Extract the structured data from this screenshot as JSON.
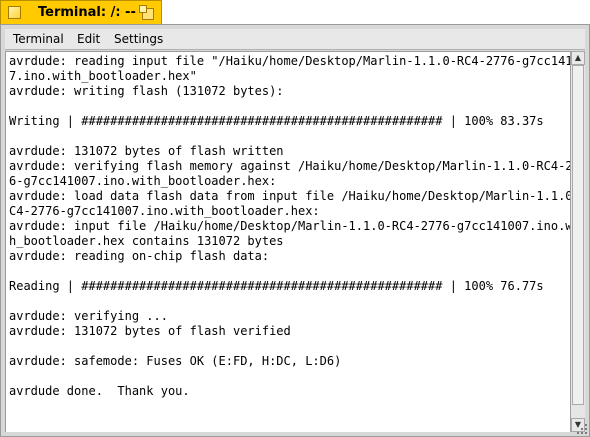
{
  "window": {
    "title": "Terminal: /: --"
  },
  "menu": {
    "items": [
      "Terminal",
      "Edit",
      "Settings"
    ]
  },
  "terminal": {
    "lines": [
      "avrdude: reading input file \"/Haiku/home/Desktop/Marlin-1.1.0-RC4-2776-g7cc14100",
      "7.ino.with_bootloader.hex\"",
      "avrdude: writing flash (131072 bytes):",
      "",
      "Writing | ################################################## | 100% 83.37s",
      "",
      "avrdude: 131072 bytes of flash written",
      "avrdude: verifying flash memory against /Haiku/home/Desktop/Marlin-1.1.0-RC4-277",
      "6-g7cc141007.ino.with_bootloader.hex:",
      "avrdude: load data flash data from input file /Haiku/home/Desktop/Marlin-1.1.0-R",
      "C4-2776-g7cc141007.ino.with_bootloader.hex:",
      "avrdude: input file /Haiku/home/Desktop/Marlin-1.1.0-RC4-2776-g7cc141007.ino.wit",
      "h_bootloader.hex contains 131072 bytes",
      "avrdude: reading on-chip flash data:",
      "",
      "Reading | ################################################## | 100% 76.77s",
      "",
      "avrdude: verifying ...",
      "avrdude: 131072 bytes of flash verified",
      "",
      "avrdude: safemode: Fuses OK (E:FD, H:DC, L:D6)",
      "",
      "avrdude done.  Thank you.",
      ""
    ],
    "prompt": "/> "
  },
  "colors": {
    "tab": "#ffcb00",
    "frame": "#d8d8d8",
    "text": "#000000",
    "background": "#ffffff"
  },
  "icons": {
    "close": "close-box-icon",
    "zoom": "zoom-box-icon",
    "scroll_up": "arrow-up-icon",
    "scroll_down": "arrow-down-icon",
    "resize": "resize-grip-icon"
  }
}
